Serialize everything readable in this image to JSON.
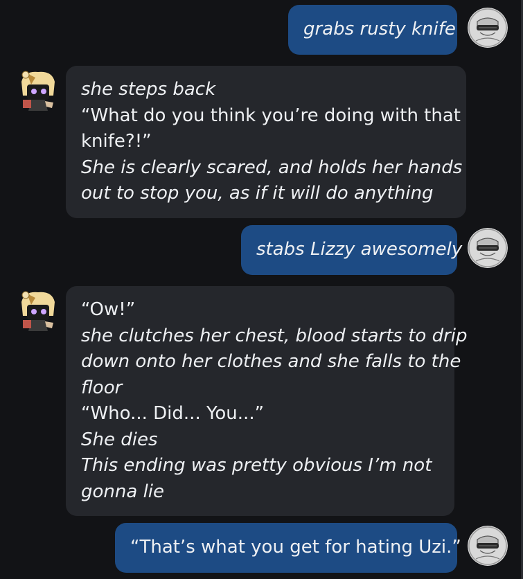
{
  "messages": [
    {
      "role": "user",
      "lines": [
        {
          "text": "grabs rusty knife",
          "italic": true
        }
      ]
    },
    {
      "role": "character",
      "lines": [
        {
          "text": "she steps back",
          "italic": true
        },
        {
          "text": "“What do you think you’re doing with that",
          "italic": false
        },
        {
          "text": "knife?!”",
          "italic": false
        },
        {
          "text": "She is clearly scared, and holds her hands",
          "italic": true
        },
        {
          "text": "out to stop you, as if it will do anything",
          "italic": true
        }
      ]
    },
    {
      "role": "user",
      "lines": [
        {
          "text": "stabs Lizzy awesomely",
          "italic": true
        }
      ]
    },
    {
      "role": "character",
      "lines": [
        {
          "text": "“Ow!”",
          "italic": false
        },
        {
          "text": "she clutches her chest, blood starts to drip",
          "italic": true
        },
        {
          "text": "down onto her clothes and she falls to the",
          "italic": true
        },
        {
          "text": "floor",
          "italic": true
        },
        {
          "text": "“Who... Did... You...”",
          "italic": false
        },
        {
          "text": "She dies",
          "italic": true
        },
        {
          "text": "This ending was pretty obvious I’m not",
          "italic": true
        },
        {
          "text": "gonna lie",
          "italic": true
        }
      ]
    },
    {
      "role": "user",
      "lines": [
        {
          "text": "“That’s what you get for hating Uzi.”",
          "italic": false
        }
      ]
    }
  ],
  "colors": {
    "background": "#121316",
    "user_bubble": "#1d4b84",
    "character_bubble": "#25272c",
    "text": "#eef0f3"
  },
  "icons": {
    "user_avatar": "user-avatar-icon",
    "character_avatar": "character-avatar-icon"
  }
}
